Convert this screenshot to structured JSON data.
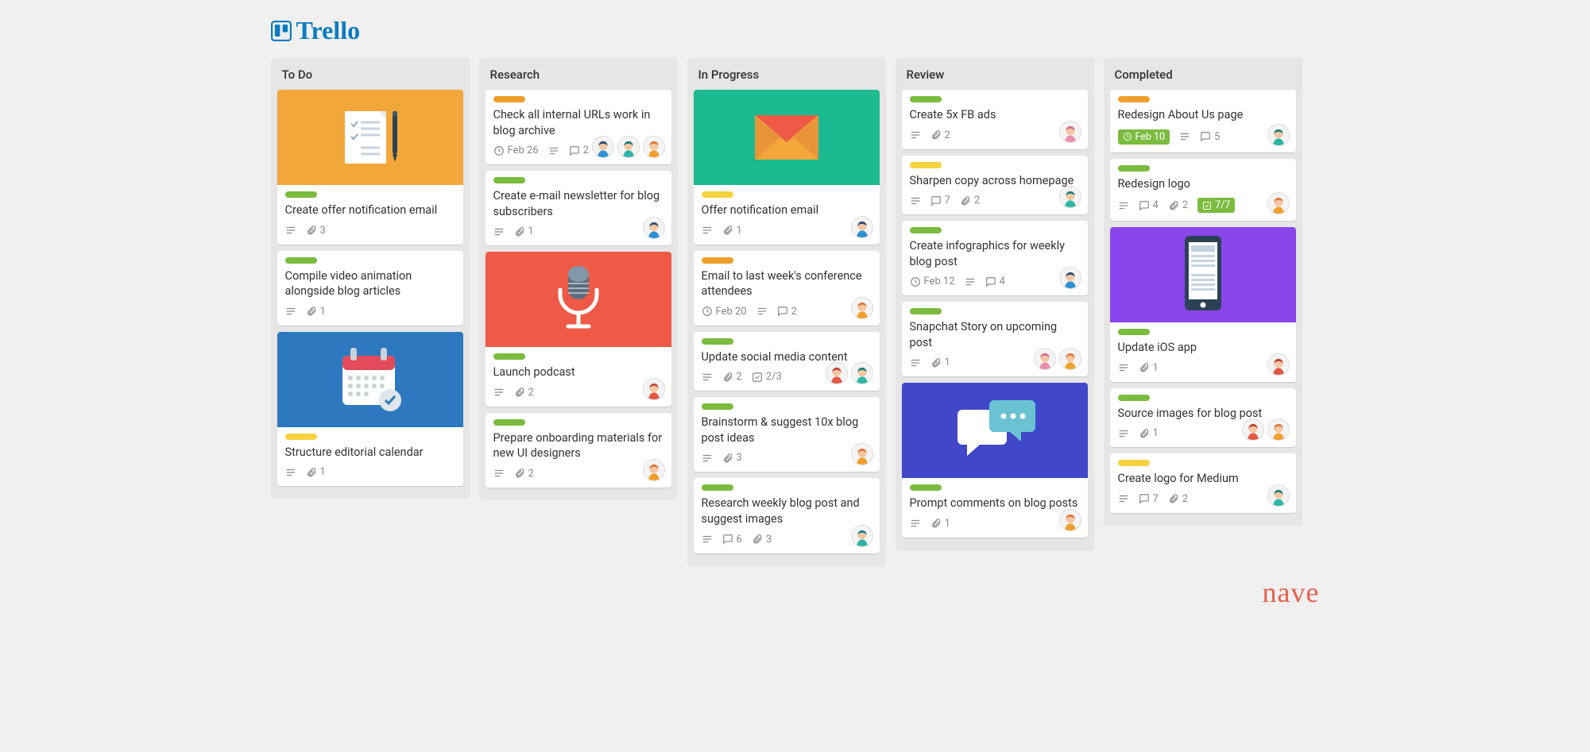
{
  "app": {
    "name": "Trello"
  },
  "footer": {
    "brand": "nave"
  },
  "avatarColors": {
    "blue": {
      "hair": "#2b4f70",
      "skin": "#f6c7a4",
      "shirt": "#2e91d4"
    },
    "teal": {
      "hair": "#1a7f7a",
      "skin": "#f6c7a4",
      "shirt": "#2fb5a8"
    },
    "orange": {
      "hair": "#e07a3c",
      "skin": "#f6c7a4",
      "shirt": "#f09f2d"
    },
    "red": {
      "hair": "#c44536",
      "skin": "#f6c7a4",
      "shirt": "#e25744"
    },
    "pink": {
      "hair": "#d46a8a",
      "skin": "#f6c7a4",
      "shirt": "#e98fab"
    }
  },
  "lists": [
    {
      "title": "To Do",
      "cards": [
        {
          "cover": "document",
          "coverBg": "#f2a73b",
          "labels": [
            "green"
          ],
          "title": "Create offer notification email",
          "badges": {
            "desc": true,
            "attach": 3
          }
        },
        {
          "labels": [
            "green"
          ],
          "title": "Compile video animation alongside blog articles",
          "badges": {
            "desc": true,
            "attach": 1
          }
        },
        {
          "cover": "calendar",
          "coverBg": "#2d78bf",
          "labels": [
            "yellow"
          ],
          "title": "Structure editorial calendar",
          "badges": {
            "desc": true,
            "attach": 1
          }
        }
      ]
    },
    {
      "title": "Research",
      "cards": [
        {
          "labels": [
            "orange"
          ],
          "title": "Check all internal URLs work in blog archive",
          "badges": {
            "due": "Feb 26",
            "desc": true,
            "comments": 2
          },
          "members": [
            "blue",
            "teal",
            "orange"
          ]
        },
        {
          "labels": [
            "green"
          ],
          "title": "Create e-mail newsletter for blog subscribers",
          "badges": {
            "desc": true,
            "attach": 1
          },
          "members": [
            "blue"
          ]
        },
        {
          "cover": "mic",
          "coverBg": "#ee5a46",
          "labels": [
            "green"
          ],
          "title": "Launch podcast",
          "badges": {
            "desc": true,
            "attach": 2
          },
          "members": [
            "red"
          ]
        },
        {
          "labels": [
            "green"
          ],
          "title": "Prepare onboarding materials for new UI designers",
          "badges": {
            "desc": true,
            "attach": 2
          },
          "members": [
            "orange"
          ]
        }
      ]
    },
    {
      "title": "In Progress",
      "cards": [
        {
          "cover": "mail",
          "coverBg": "#1bba90",
          "labels": [
            "yellow"
          ],
          "title": "Offer notification email",
          "badges": {
            "desc": true,
            "attach": 1
          },
          "members": [
            "blue"
          ]
        },
        {
          "labels": [
            "orange"
          ],
          "title": "Email to last week's conference attendees",
          "badges": {
            "due": "Feb 20",
            "desc": true,
            "comments": 2
          },
          "members": [
            "orange"
          ]
        },
        {
          "labels": [
            "green"
          ],
          "title": "Update social media content",
          "badges": {
            "desc": true,
            "attach": 2,
            "check": "2/3"
          },
          "members": [
            "red",
            "teal"
          ]
        },
        {
          "labels": [
            "green"
          ],
          "title": "Brainstorm & suggest 10x blog post ideas",
          "badges": {
            "desc": true,
            "attach": 3
          },
          "members": [
            "orange"
          ]
        },
        {
          "labels": [
            "green"
          ],
          "title": "Research weekly blog post and suggest images",
          "badges": {
            "desc": true,
            "attach": 3,
            "comments": 6
          },
          "members": [
            "teal"
          ]
        }
      ]
    },
    {
      "title": "Review",
      "cards": [
        {
          "labels": [
            "green"
          ],
          "title": "Create 5x FB ads",
          "badges": {
            "desc": true,
            "attach": 2
          },
          "members": [
            "pink"
          ]
        },
        {
          "labels": [
            "yellow"
          ],
          "title": "Sharpen copy across homepage",
          "badges": {
            "desc": true,
            "comments": 7,
            "attach": 2
          },
          "members": [
            "teal"
          ]
        },
        {
          "labels": [
            "green"
          ],
          "title": "Create infographics for weekly blog post",
          "badges": {
            "due": "Feb 12",
            "desc": true,
            "comments": 4
          },
          "members": [
            "blue"
          ]
        },
        {
          "labels": [
            "green"
          ],
          "title": "Snapchat Story on upcoming post",
          "badges": {
            "desc": true,
            "attach": 1
          },
          "members": [
            "pink",
            "orange"
          ]
        },
        {
          "cover": "chat",
          "coverBg": "#4047c9",
          "labels": [
            "green"
          ],
          "title": "Prompt comments on blog posts",
          "badges": {
            "desc": true,
            "attach": 1
          },
          "members": [
            "orange"
          ]
        }
      ]
    },
    {
      "title": "Completed",
      "cards": [
        {
          "labels": [
            "orange"
          ],
          "title": "Redesign About Us page",
          "badges": {
            "duePill": "Feb 10",
            "desc": true,
            "comments": 5
          },
          "members": [
            "teal"
          ]
        },
        {
          "labels": [
            "green"
          ],
          "title": "Redesign logo",
          "badges": {
            "desc": true,
            "comments": 4,
            "attach": 2,
            "checkPill": "7/7"
          },
          "members": [
            "orange"
          ]
        },
        {
          "cover": "phone",
          "coverBg": "#8b46eb",
          "labels": [
            "green"
          ],
          "title": "Update iOS app",
          "badges": {
            "desc": true,
            "attach": 1
          },
          "members": [
            "red"
          ]
        },
        {
          "labels": [
            "green"
          ],
          "title": "Source images for blog post",
          "badges": {
            "desc": true,
            "attach": 1
          },
          "members": [
            "red",
            "orange"
          ]
        },
        {
          "labels": [
            "yellow"
          ],
          "title": "Create logo for Medium",
          "badges": {
            "desc": true,
            "comments": 7,
            "attach": 2
          },
          "members": [
            "teal"
          ]
        }
      ]
    }
  ]
}
